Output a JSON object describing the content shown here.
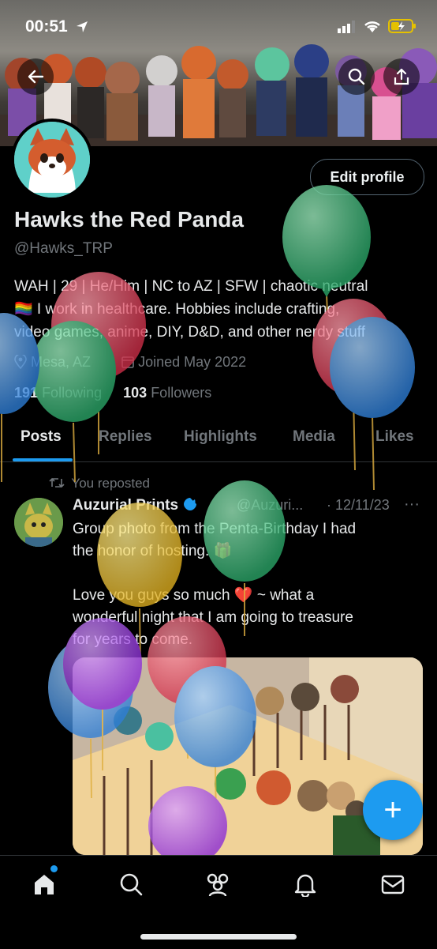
{
  "status_bar": {
    "time": "00:51"
  },
  "profile": {
    "name": "Hawks the Red Panda",
    "handle": "@Hawks_TRP",
    "edit_label": "Edit profile",
    "bio_line1": "WAH | 29 | He/Him | NC to AZ | SFW | chaotic neutral",
    "bio_line2": "🏳️‍🌈 I work in healthcare. Hobbies include crafting,",
    "bio_line3": "video games, anime, DIY, D&D, and other nerdy stuff",
    "location": "Mesa, AZ",
    "joined": "Joined May 2022",
    "following_count": "191",
    "following_label": "Following",
    "followers_count": "103",
    "followers_label": "Followers"
  },
  "tabs": [
    "Posts",
    "Replies",
    "Highlights",
    "Media",
    "Likes"
  ],
  "post": {
    "repost_label": "You reposted",
    "author": "Auzurial Prints",
    "author_handle": "@Auzuri...",
    "date": "· 12/11/23",
    "more": "···",
    "text_line1": "Group photo from the Penta-Birthday I had",
    "text_line2": "the honor of hosting. 🎁",
    "text_line3": "Love you guys so much ❤️ ~ what a",
    "text_line4": "wonderful night that I am going to treasure",
    "text_line5": "for years to come."
  },
  "fab_label": "+",
  "colors": {
    "accent": "#1d9bf0",
    "background": "#000000",
    "muted": "#71767b"
  }
}
